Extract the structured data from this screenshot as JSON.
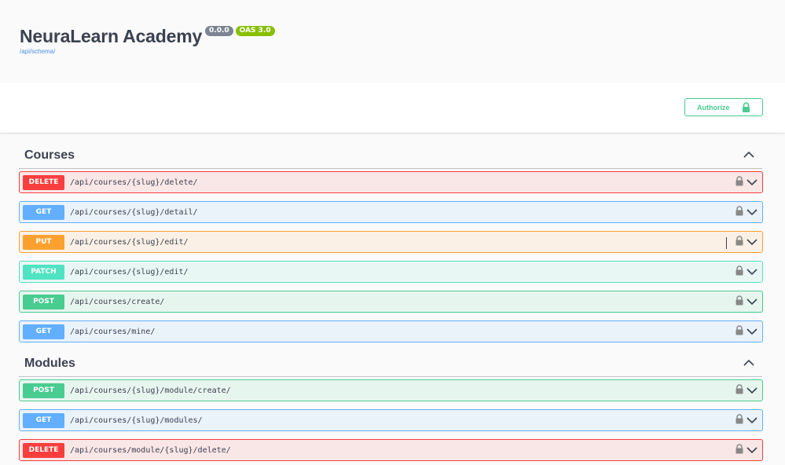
{
  "info": {
    "title": "NeuraLearn Academy",
    "version_badge": "0.0.0",
    "oas_badge": "OAS 3.0",
    "schema_link": "/api/schema/"
  },
  "scheme": {
    "authorize_label": "Authorize"
  },
  "sections": [
    {
      "title": "Courses",
      "operations": [
        {
          "method": "DELETE",
          "path": "/api/courses/{slug}/delete/"
        },
        {
          "method": "GET",
          "path": "/api/courses/{slug}/detail/"
        },
        {
          "method": "PUT",
          "path": "/api/courses/{slug}/edit/"
        },
        {
          "method": "PATCH",
          "path": "/api/courses/{slug}/edit/"
        },
        {
          "method": "POST",
          "path": "/api/courses/create/"
        },
        {
          "method": "GET",
          "path": "/api/courses/mine/"
        }
      ]
    },
    {
      "title": "Modules",
      "operations": [
        {
          "method": "POST",
          "path": "/api/courses/{slug}/module/create/"
        },
        {
          "method": "GET",
          "path": "/api/courses/{slug}/modules/"
        },
        {
          "method": "DELETE",
          "path": "/api/courses/module/{slug}/delete/"
        }
      ]
    }
  ],
  "colors": {
    "delete": "#f93e3e",
    "get": "#61affe",
    "put": "#fca130",
    "patch": "#50e3c2",
    "post": "#49cc90"
  },
  "icons": {
    "lock": "lock-icon",
    "chevron_down": "chevron-down-icon",
    "chevron_up": "chevron-up-icon"
  }
}
